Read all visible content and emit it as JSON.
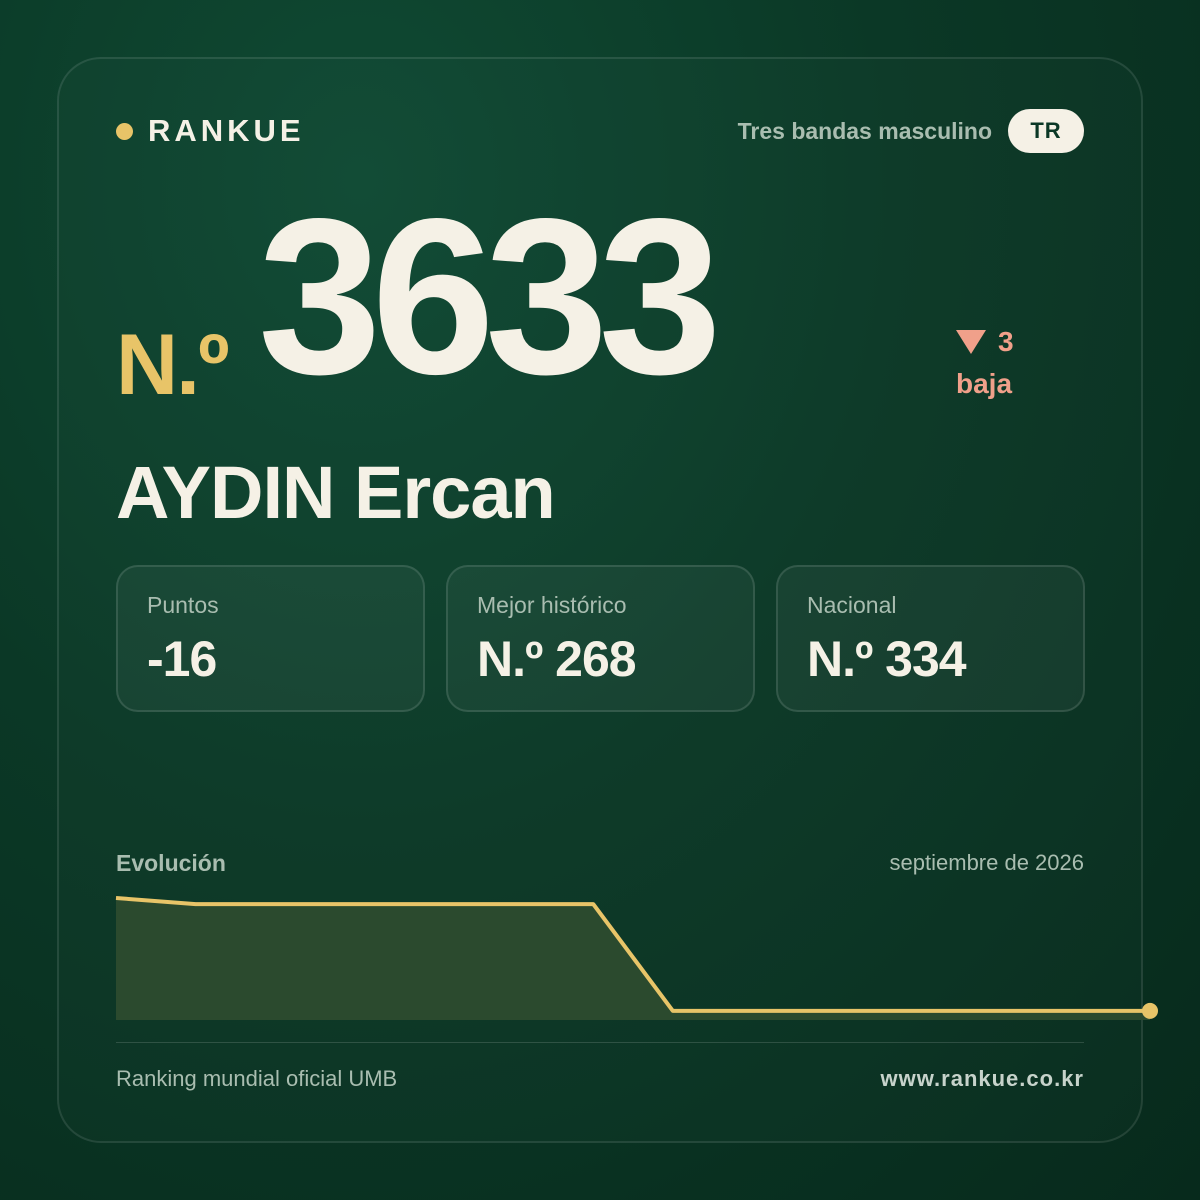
{
  "brand": {
    "name": "RANKUE"
  },
  "header": {
    "category": "Tres bandas masculino",
    "country_code": "TR"
  },
  "rank": {
    "prefix": "N.º",
    "number": "3633",
    "change_value": "3",
    "change_label": "baja",
    "change_direction": "down"
  },
  "player": {
    "name": "AYDIN Ercan"
  },
  "stats": [
    {
      "label": "Puntos",
      "value": "-16"
    },
    {
      "label": "Mejor histórico",
      "value": "N.º 268"
    },
    {
      "label": "Nacional",
      "value": "N.º 334"
    }
  ],
  "evolution": {
    "title": "Evolución",
    "date": "septiembre de 2026"
  },
  "chart_data": {
    "type": "area",
    "x": [
      0,
      1,
      2,
      3,
      4,
      5,
      6,
      7,
      8,
      9,
      10,
      11,
      12,
      13
    ],
    "values": [
      40,
      38,
      38,
      38,
      38,
      38,
      38,
      3,
      3,
      3,
      3,
      3,
      3,
      3
    ],
    "xlabel": "",
    "ylabel": "",
    "grid": false
  },
  "footer": {
    "source": "Ranking mundial oficial UMB",
    "url": "www.rankue.co.kr"
  },
  "colors": {
    "accent": "#e8c468",
    "down": "#f0a08a",
    "text": "#f5f1e6",
    "muted": "#a9bdb0"
  }
}
